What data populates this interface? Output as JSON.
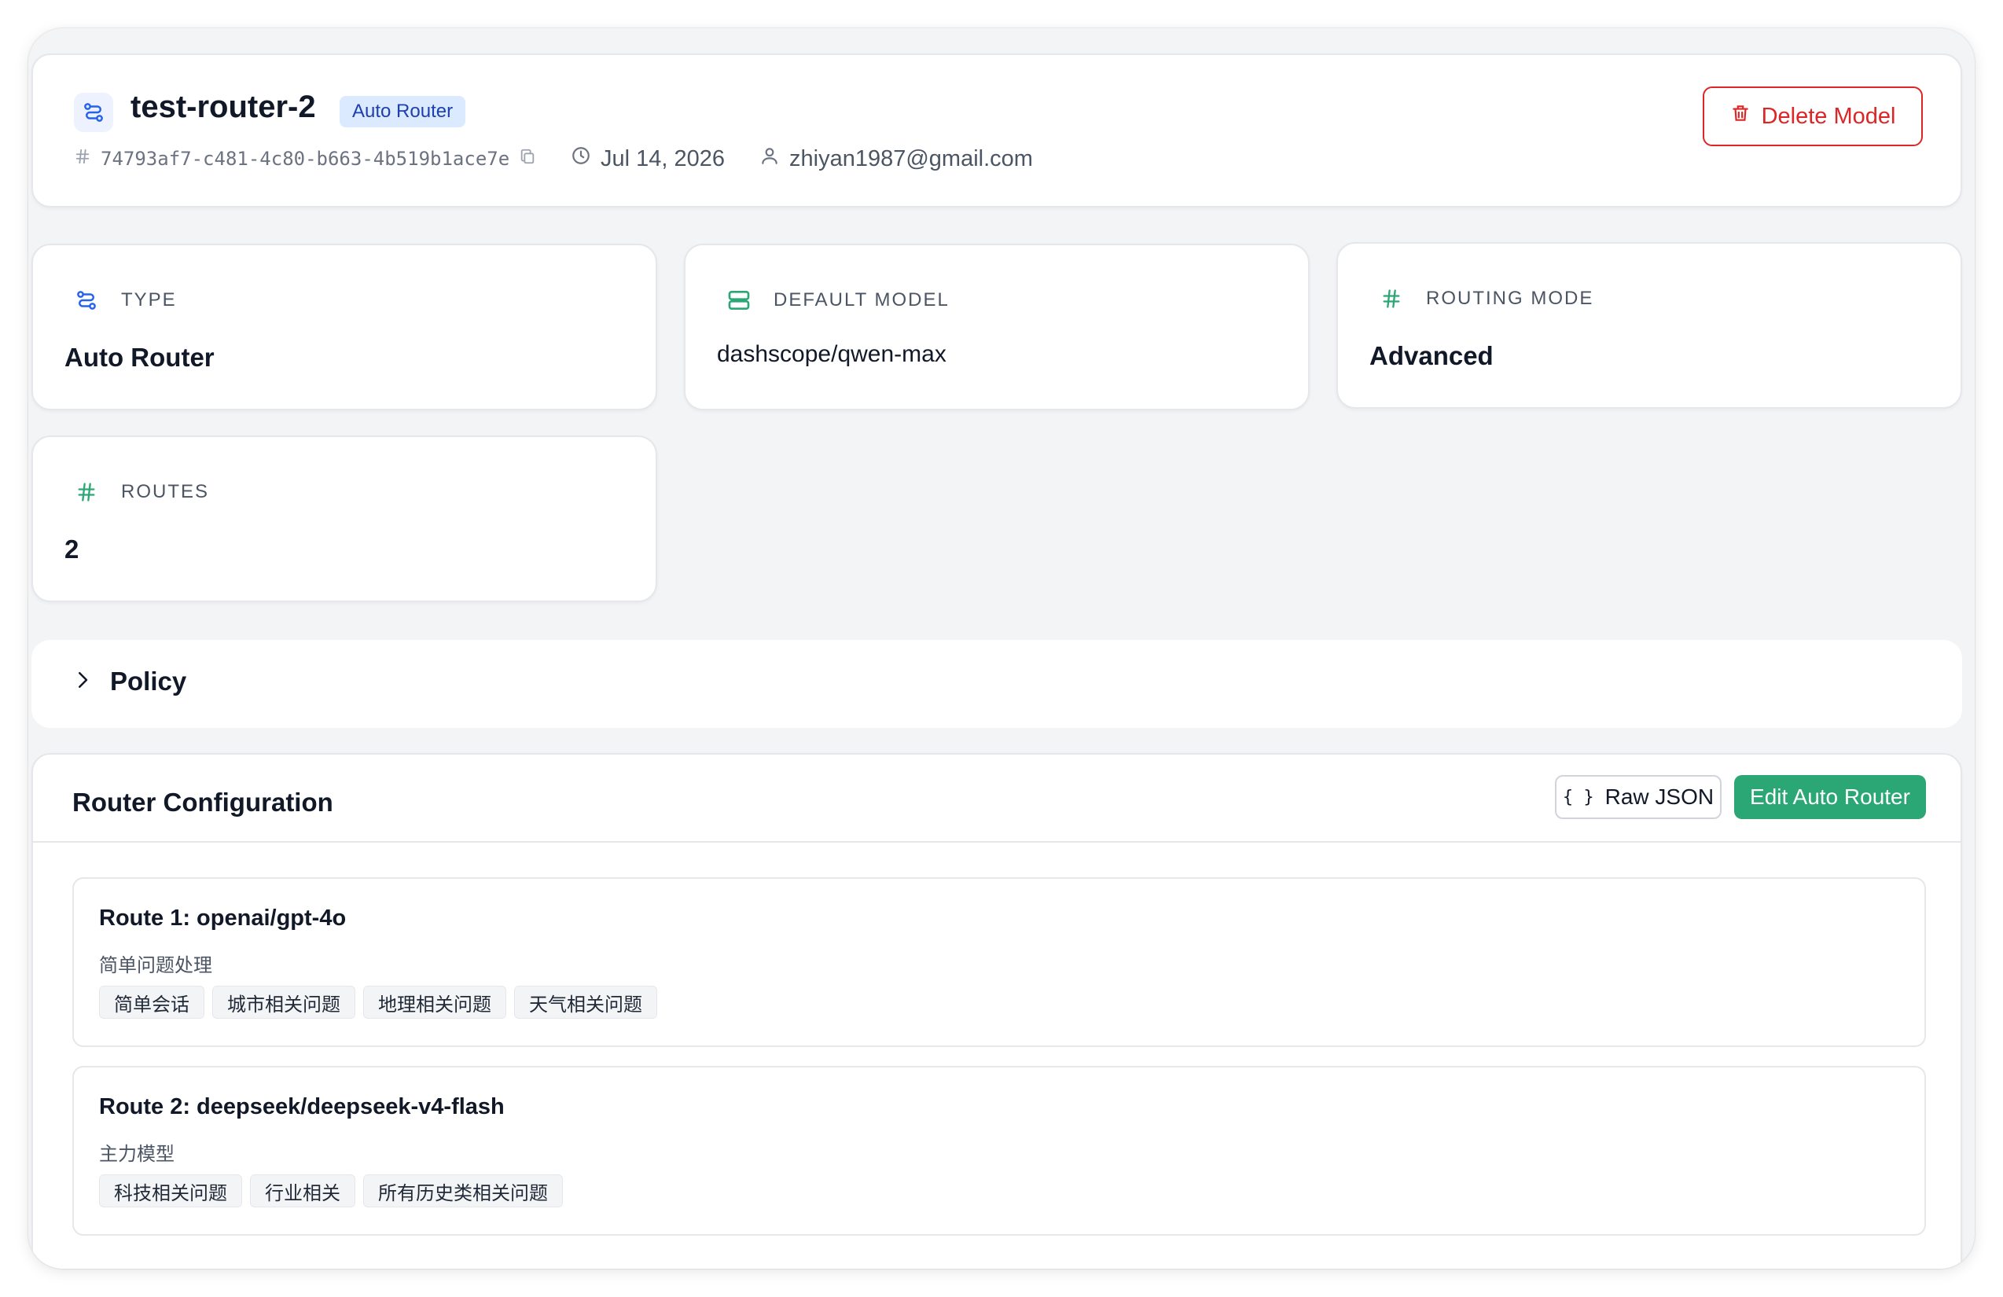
{
  "header": {
    "title": "test-router-2",
    "badge": "Auto Router",
    "model_id": "74793af7-c481-4c80-b663-4b519b1ace7e",
    "date": "Jul 14, 2026",
    "owner": "zhiyan1987@gmail.com",
    "delete_label": "Delete Model"
  },
  "stats": {
    "type": {
      "label": "TYPE",
      "value": "Auto Router"
    },
    "default_model": {
      "label": "DEFAULT MODEL",
      "value": "dashscope/qwen-max"
    },
    "routing_mode": {
      "label": "ROUTING MODE",
      "value": "Advanced"
    },
    "routes": {
      "label": "ROUTES",
      "value": "2"
    }
  },
  "policy": {
    "title": "Policy"
  },
  "config": {
    "title": "Router Configuration",
    "raw_json_label": "Raw JSON",
    "raw_json_icon": "{ }",
    "edit_label": "Edit Auto Router",
    "routes": [
      {
        "title": "Route 1: openai/gpt-4o",
        "description": "简单问题处理",
        "tags": [
          "简单会话",
          "城市相关问题",
          "地理相关问题",
          "天气相关问题"
        ]
      },
      {
        "title": "Route 2: deepseek/deepseek-v4-flash",
        "description": "主力模型",
        "tags": [
          "科技相关问题",
          "行业相关",
          "所有历史类相关问题"
        ]
      }
    ]
  },
  "icons": {
    "router": "route-icon",
    "hash": "hash-icon",
    "copy": "copy-icon",
    "clock": "clock-icon",
    "user": "user-icon",
    "trash": "trash-icon",
    "server": "server-icon",
    "chevron": "chevron-right-icon"
  },
  "colors": {
    "primary_blue": "#2563eb",
    "green": "#2aa774",
    "danger": "#dc2626",
    "background": "#f3f4f6"
  }
}
